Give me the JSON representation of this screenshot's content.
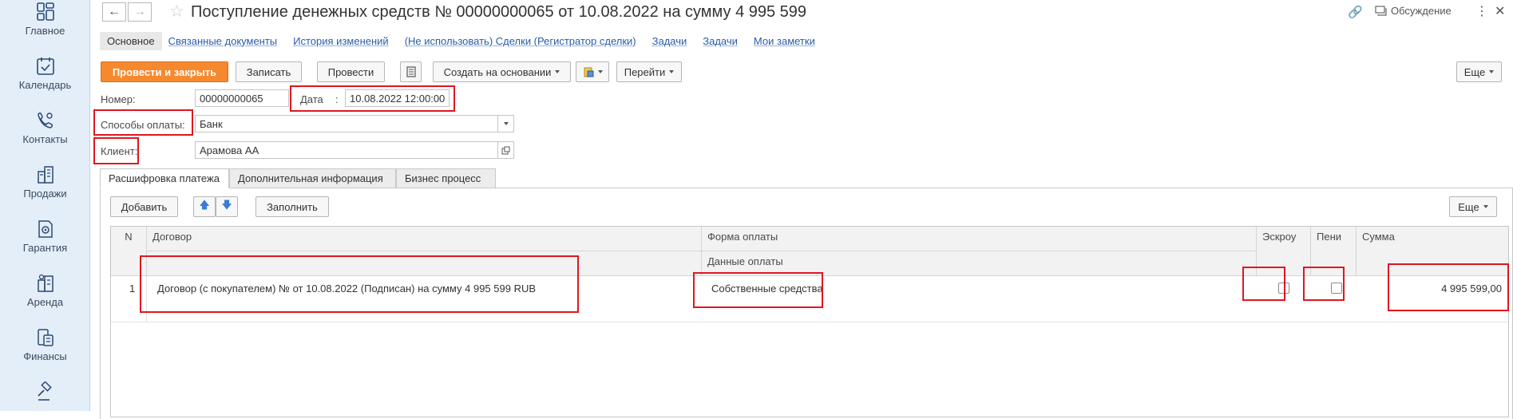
{
  "sidebar": {
    "items": [
      {
        "label": "Главное",
        "icon": "dashboard-icon"
      },
      {
        "label": "Календарь",
        "icon": "calendar-icon"
      },
      {
        "label": "Контакты",
        "icon": "contacts-icon"
      },
      {
        "label": "Продажи",
        "icon": "buildings-icon"
      },
      {
        "label": "Гарантия",
        "icon": "warranty-icon"
      },
      {
        "label": "Аренда",
        "icon": "rent-icon"
      },
      {
        "label": "Финансы",
        "icon": "finance-icon"
      }
    ]
  },
  "header": {
    "title": "Поступление денежных средств № 00000000065 от 10.08.2022 на сумму 4 995 599",
    "discussion_label": "Обсуждение",
    "back_icon": "arrow-left-icon",
    "forward_icon": "arrow-right-icon"
  },
  "links": {
    "active": "Основное",
    "items": [
      "Связанные документы",
      "История изменений",
      "(Не использовать) Сделки (Регистратор сделки)",
      "Задачи",
      "Задачи",
      "Мои заметки"
    ]
  },
  "toolbar": {
    "post_close": "Провести и закрыть",
    "save": "Записать",
    "post": "Провести",
    "create_based": "Создать на основании",
    "goto": "Перейти",
    "more": "Еще"
  },
  "form": {
    "number_label": "Номер:",
    "number_value": "00000000065",
    "date_label": "Дата",
    "date_sep": ":",
    "date_value": "10.08.2022 12:00:00",
    "payment_label": "Способы оплаты:",
    "payment_value": "Банк",
    "client_label": "Клиент:",
    "client_value": "Арамова АА"
  },
  "tabs": [
    "Расшифровка платежа",
    "Дополнительная информация",
    "Бизнес процесс"
  ],
  "table_toolbar": {
    "add": "Добавить",
    "fill": "Заполнить",
    "more": "Еще"
  },
  "table": {
    "headers": {
      "n": "N",
      "contract": "Договор",
      "pay_form": "Форма оплаты",
      "pay_data": "Данные оплаты",
      "escrow": "Эскроу",
      "penalty": "Пени",
      "sum": "Сумма"
    },
    "rows": [
      {
        "n": "1",
        "contract": "Договор (с покупателем) №  от 10.08.2022 (Подписан) на сумму 4 995 599 RUB",
        "pay_form": "Собственные средства",
        "escrow": false,
        "penalty": false,
        "sum": "4 995 599,00"
      }
    ]
  },
  "colors": {
    "accent": "#f6892e",
    "link": "#2a5ca8",
    "highlight": "#e0161f",
    "sidebar_bg": "#e4eef9"
  }
}
